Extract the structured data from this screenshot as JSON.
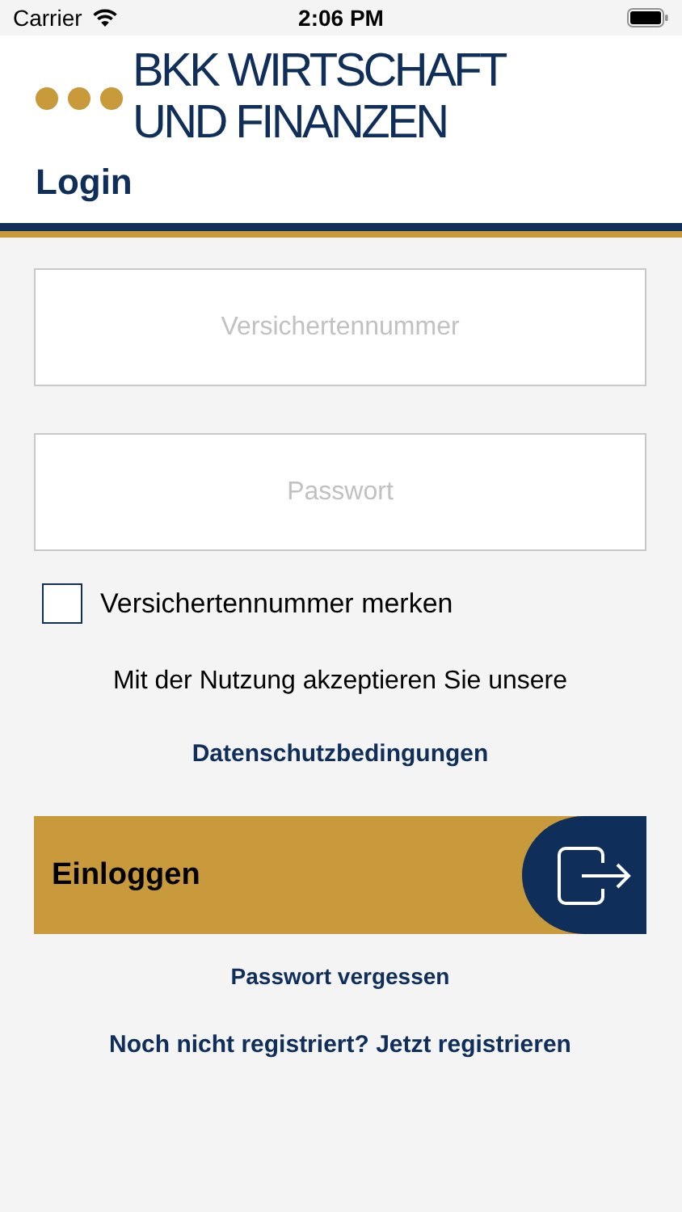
{
  "status_bar": {
    "carrier": "Carrier",
    "time": "2:06 PM"
  },
  "header": {
    "logo_lines": [
      "BKK WIRTSCHAFT",
      "UND FINANZEN"
    ],
    "title": "Login"
  },
  "fields": [
    {
      "placeholder": "Versichertennummer"
    },
    {
      "placeholder": "Passwort"
    }
  ],
  "remember": {
    "label": "Versichertennummer merken",
    "checked": false
  },
  "terms": {
    "text": "Mit der Nutzung akzeptieren Sie unsere",
    "link": "Datenschutzbedingungen"
  },
  "login_button": {
    "label": "Einloggen"
  },
  "links": [
    "Passwort vergessen",
    "Noch nicht registriert? Jetzt registrieren"
  ]
}
